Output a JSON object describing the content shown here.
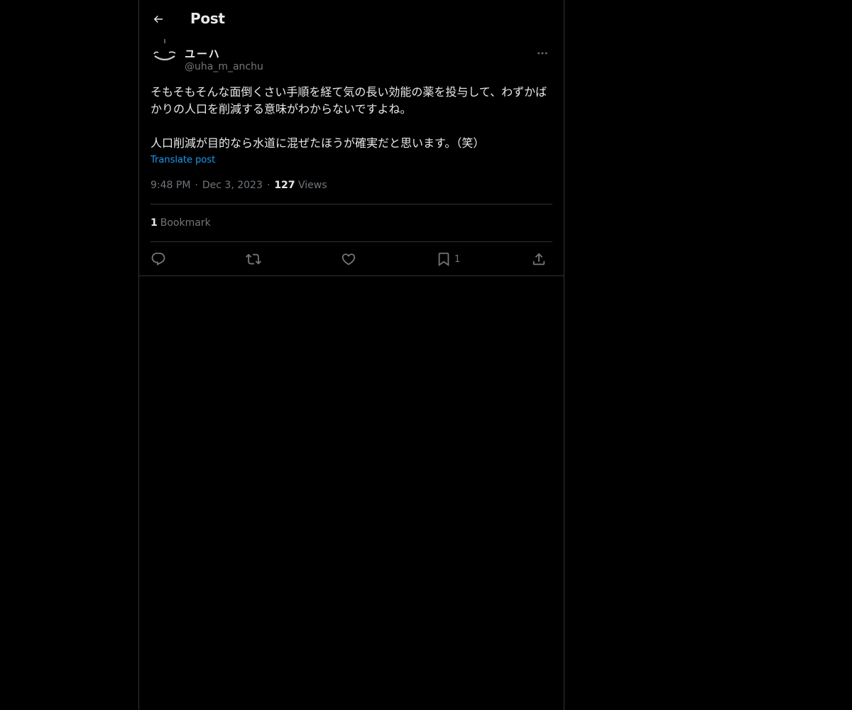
{
  "header": {
    "title": "Post"
  },
  "author": {
    "display_name": "ユーハ",
    "handle": "@uha_m_anchu"
  },
  "post": {
    "paragraph_1": "そもそもそんな面倒くさい手順を経て気の長い効能の薬を投与して、わずかばかりの人口を削減する意味がわからないですよね。",
    "paragraph_2": "人口削減が目的なら水道に混ぜたほうが確実だと思います。（笑）",
    "translate_label": "Translate post"
  },
  "meta": {
    "time": "9:48 PM",
    "separator": "·",
    "date": "Dec 3, 2023",
    "views_count": "127",
    "views_label": "Views"
  },
  "bookmarks": {
    "count": "1",
    "label": "Bookmark"
  },
  "actions": {
    "reply_icon": "reply-icon",
    "repost_icon": "repost-icon",
    "like_icon": "heart-icon",
    "bookmark_icon": "bookmark-icon",
    "bookmark_count": "1",
    "share_icon": "share-icon"
  },
  "colors": {
    "background": "#000000",
    "text_primary": "#e7e9ea",
    "text_secondary": "#71767b",
    "accent": "#1d9bf0",
    "border": "#2f3336"
  }
}
